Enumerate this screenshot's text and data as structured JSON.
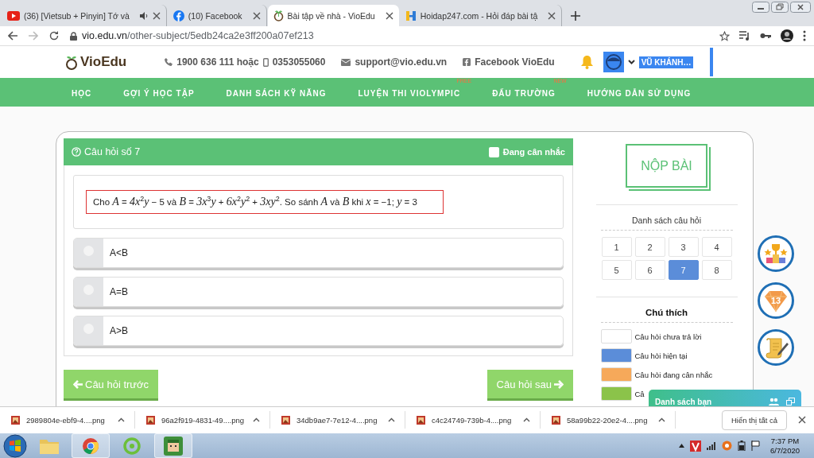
{
  "browser": {
    "tabs": [
      {
        "title": "(36) [Vietsub + Pinyin] Tớ và",
        "kind": "youtube",
        "audio": true,
        "selected": false
      },
      {
        "title": "(10) Facebook",
        "kind": "facebook",
        "audio": false,
        "selected": false
      },
      {
        "title": "Bài tập về nhà - VioEdu",
        "kind": "vioedu",
        "audio": false,
        "selected": true
      },
      {
        "title": "Hoidap247.com - Hỏi đáp bài tậ",
        "kind": "hoidap",
        "audio": false,
        "selected": false
      }
    ],
    "url_host": "vio.edu.vn",
    "url_path": "/other-subject/5edb24ca2e3ff200a07ef213"
  },
  "header": {
    "logo": "VioEdu",
    "phone": "1900 636 111 hoặc",
    "mobile": "0353055060",
    "email": "support@vio.edu.vn",
    "facebook": "Facebook VioEdu",
    "user": "VŨ KHÁNH…"
  },
  "nav": [
    {
      "label": "HỌC"
    },
    {
      "label": "GỢI Ý HỌC TẬP"
    },
    {
      "label": "DANH SÁCH KỸ NĂNG"
    },
    {
      "label": "LUYỆN THI VIOLYMPIC",
      "badge": "FREE"
    },
    {
      "label": "ĐẤU TRƯỜNG",
      "badge": "NEW"
    },
    {
      "label": "HƯỚNG DẪN SỬ DỤNG"
    }
  ],
  "question": {
    "title": "Câu hỏi số 7",
    "considering": {
      "label": "Đang cân nhắc",
      "checked": false
    },
    "text": "Cho *A* = *4x*$^{2}$*y* − 5 và *B* = *3x*$^{3}$*y* + *6x*$^{2}$*y*$^{2}$ + *3xy*$^{2}$. So sánh *A* và *B* khi *x* = −1; *y* = 3",
    "options": [
      {
        "label": "A<B",
        "selected": false
      },
      {
        "label": "A=B",
        "selected": false
      },
      {
        "label": "A>B",
        "selected": false
      }
    ],
    "prev": "Câu hỏi trước",
    "next": "Câu hỏi sau"
  },
  "side": {
    "submit": "NỘP BÀI",
    "list_title": "Danh sách câu hỏi",
    "numbers": [
      {
        "label": "1",
        "selected": false
      },
      {
        "label": "2",
        "selected": false
      },
      {
        "label": "3",
        "selected": false
      },
      {
        "label": "4",
        "selected": false
      },
      {
        "label": "5",
        "selected": false
      },
      {
        "label": "6",
        "selected": false
      },
      {
        "label": "7",
        "selected": true
      },
      {
        "label": "8",
        "selected": false
      }
    ],
    "legend_title": "Chú thích",
    "legend": [
      {
        "label": "Câu hỏi chưa trả lời",
        "color": "#ffffff"
      },
      {
        "label": "Câu hỏi hiện tại",
        "color": "#5b8dd9"
      },
      {
        "label": "Câu hỏi đang cân nhắc",
        "color": "#f6a95a"
      },
      {
        "label": "Câ",
        "color": "#8bc34a"
      }
    ]
  },
  "gem_count": "13",
  "chat": {
    "title": "Danh sách bạn"
  },
  "downloads": {
    "items": [
      {
        "name": "2989804e-ebf9-4....png"
      },
      {
        "name": "96a2f919-4831-49....png"
      },
      {
        "name": "34db9ae7-7e12-4....png"
      },
      {
        "name": "c4c24749-739b-4....png"
      },
      {
        "name": "58a99b22-20e2-4....png"
      }
    ],
    "show_all": "Hiển thị tất cả"
  },
  "taskbar": {
    "time": "7:37 PM",
    "date": "6/7/2020"
  }
}
